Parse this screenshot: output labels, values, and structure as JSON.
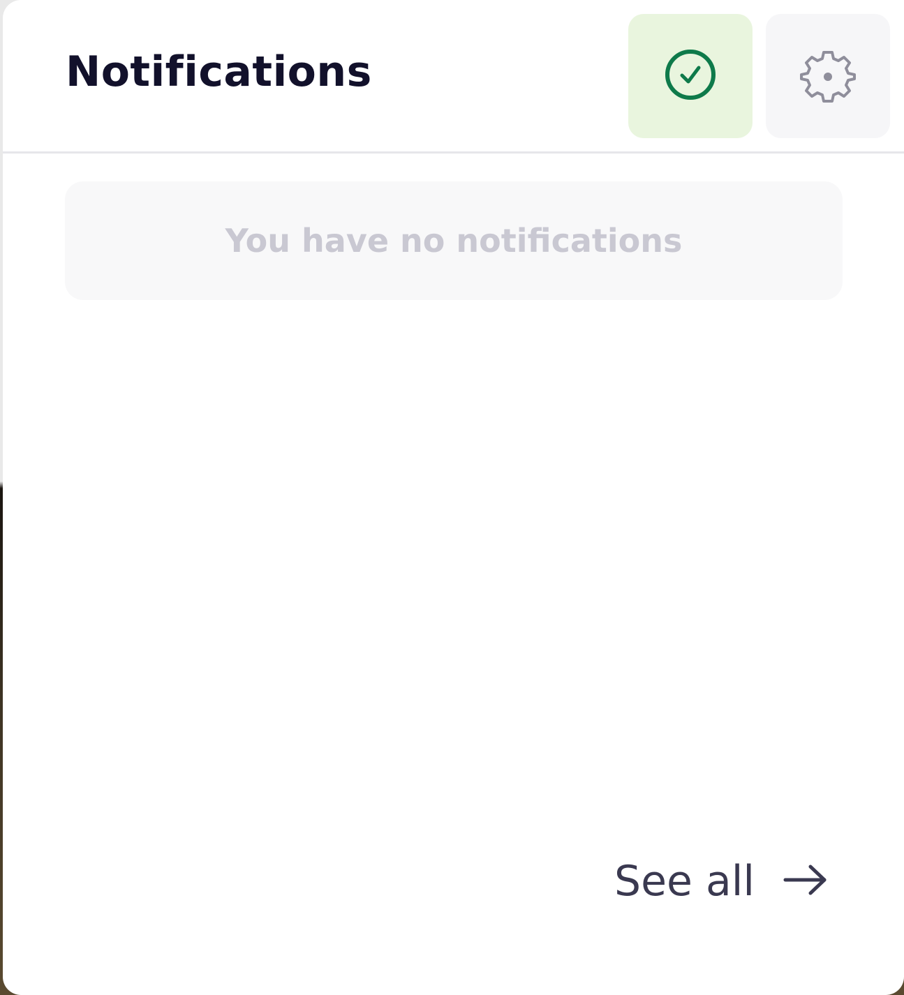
{
  "header": {
    "title": "Notifications",
    "mark_all_read_icon": "check-circle-icon",
    "settings_icon": "gear-icon"
  },
  "empty_state": {
    "message": "You have no notifications"
  },
  "footer": {
    "see_all_label": "See all",
    "see_all_icon": "arrow-right-icon"
  },
  "colors": {
    "accent_green": "#0e7a4a",
    "mark_read_bg": "#e9f5de",
    "title_text": "#12112b",
    "muted_text": "#c9c8d2"
  }
}
